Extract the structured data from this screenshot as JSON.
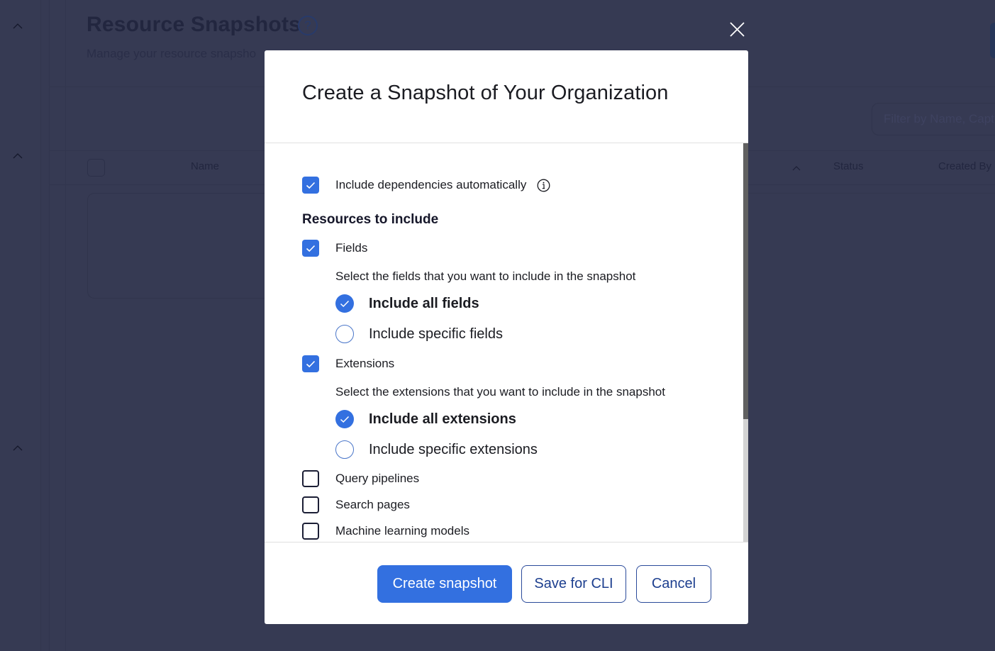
{
  "background_page": {
    "title": "Resource Snapshots",
    "help_icon": "question-circle-icon",
    "help_glyph": "?",
    "subtitle": "Manage your resource snapsho",
    "filter_placeholder": "Filter by Name, Capt",
    "columns": [
      "Name",
      "Status",
      "Created By"
    ],
    "sort_icon": "chevron-up-icon"
  },
  "modal": {
    "close_icon": "close-icon",
    "title": "Create a Snapshot of Your Organization",
    "include_dependencies": {
      "label": "Include dependencies automatically",
      "checked": true,
      "info_icon": "info-circle-icon"
    },
    "resources_heading": "Resources to include",
    "resources": [
      {
        "label": "Fields",
        "checked": true,
        "hint": "Select the fields that you want to include in the snapshot",
        "options": [
          {
            "label": "Include all fields",
            "selected": true
          },
          {
            "label": "Include specific fields",
            "selected": false
          }
        ]
      },
      {
        "label": "Extensions",
        "checked": true,
        "hint": "Select the extensions that you want to include in the snapshot",
        "options": [
          {
            "label": "Include all extensions",
            "selected": true
          },
          {
            "label": "Include specific extensions",
            "selected": false
          }
        ]
      },
      {
        "label": "Query pipelines",
        "checked": false
      },
      {
        "label": "Search pages",
        "checked": false
      },
      {
        "label": "Machine learning models",
        "checked": false
      }
    ],
    "footer": {
      "create_label": "Create snapshot",
      "save_cli_label": "Save for CLI",
      "cancel_label": "Cancel"
    }
  },
  "colors": {
    "accent": "#3370e0",
    "overlay_bg": "#363a53",
    "secondary_text": "#1d3f8f"
  }
}
